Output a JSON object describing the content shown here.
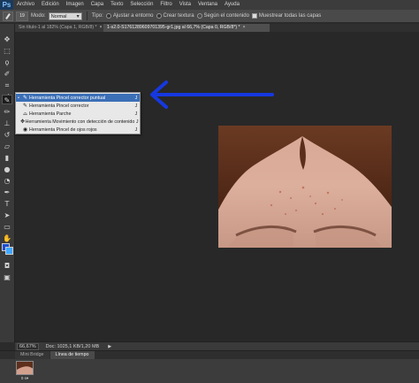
{
  "app": {
    "logo": "Ps"
  },
  "menu": [
    "Archivo",
    "Edición",
    "Imagen",
    "Capa",
    "Texto",
    "Selección",
    "Filtro",
    "Vista",
    "Ventana",
    "Ayuda"
  ],
  "options": {
    "brush_size": "19",
    "mode_label": "Modo:",
    "mode_value": "Normal",
    "type_label": "Tipo:",
    "type_options": [
      "Ajustar a entorno",
      "Crear textura",
      "Según el contenido"
    ],
    "type_selected": "Según el contenido",
    "sample_all_label": "Muestrear todas las capas"
  },
  "tabs": [
    {
      "title": "Sin título-1 al 182% (Capa 1, RGB/8) *",
      "close": "×"
    },
    {
      "title": "1-s2.0-S1761289609701395-gr1.jpg al 66,7% (Capa 0, RGB/8*) *",
      "close": "×"
    }
  ],
  "flyout": {
    "items": [
      {
        "label": "Herramienta Pincel corrector puntual",
        "key": "J",
        "icon": "spot-healing-brush-icon",
        "glyph": "✎",
        "selected": true
      },
      {
        "label": "Herramienta Pincel corrector",
        "key": "J",
        "icon": "healing-brush-icon",
        "glyph": "✎",
        "selected": false
      },
      {
        "label": "Herramienta Parche",
        "key": "J",
        "icon": "patch-icon",
        "glyph": "⌓",
        "selected": false
      },
      {
        "label": "Herramienta Movimiento con detección de contenido",
        "key": "J",
        "icon": "content-aware-move-icon",
        "glyph": "✥",
        "selected": false
      },
      {
        "label": "Herramienta Pincel de ojos rojos",
        "key": "J",
        "icon": "red-eye-icon",
        "glyph": "◉",
        "selected": false
      }
    ],
    "bullet": "•"
  },
  "annotation": {
    "arrow_color": "#1638e0"
  },
  "colors": {
    "foreground": "#1a4fd6",
    "background": "#3fa8ff",
    "menu_highlight": "#3b6fb6"
  },
  "status": {
    "zoom": "66,67%",
    "doc": "Doc: 1025,1 KB/1,20 MB",
    "arrow": "▶"
  },
  "timeline": {
    "tabs": [
      "Mini Bridge",
      "Línea de tiempo"
    ],
    "frame_label": "0 s▾"
  }
}
